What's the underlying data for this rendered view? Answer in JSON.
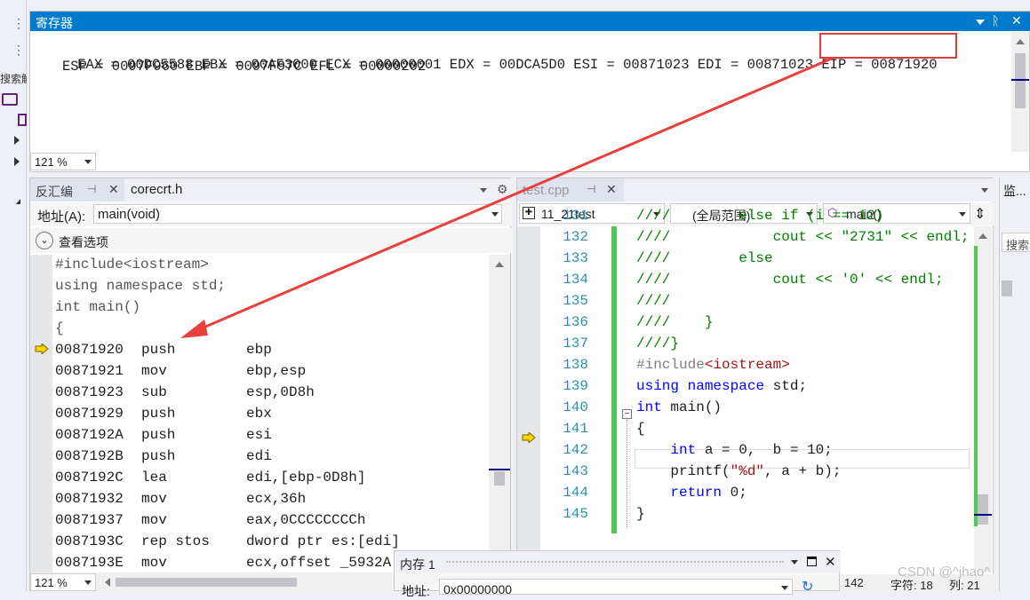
{
  "registers": {
    "title": "寄存器",
    "line1": "EAX = 00DC5588 EBX = 00AF3000 ECX = 00000001 EDX = 00DCA5D0 ESI = 00871023 EDI = 00871023 ",
    "eip": "EIP = 00871920",
    "line2": "ESP = 0097F960 EBP = 0097F97C EFL = 00000202",
    "zoom": "121 %",
    "pin_glyph": "ᚱ",
    "close_glyph": "✕"
  },
  "left_edge": {
    "dots": "⋮",
    "search_label": "搜索解"
  },
  "disasm": {
    "tab_title": "反汇编",
    "tab2": "corecrt.h",
    "address_label": "地址(A):",
    "address_value": "main(void)",
    "view_options": "查看选项",
    "zoom": "121 %",
    "source_lines": [
      "#include<iostream>",
      "using namespace std;",
      "int main()",
      "{"
    ],
    "rows": [
      {
        "addr": "00871920",
        "op": "push",
        "args": "ebp"
      },
      {
        "addr": "00871921",
        "op": "mov",
        "args": "ebp,esp"
      },
      {
        "addr": "00871923",
        "op": "sub",
        "args": "esp,0D8h"
      },
      {
        "addr": "00871929",
        "op": "push",
        "args": "ebx"
      },
      {
        "addr": "0087192A",
        "op": "push",
        "args": "esi"
      },
      {
        "addr": "0087192B",
        "op": "push",
        "args": "edi"
      },
      {
        "addr": "0087192C",
        "op": "lea",
        "args": "edi,[ebp-0D8h]"
      },
      {
        "addr": "00871932",
        "op": "mov",
        "args": "ecx,36h"
      },
      {
        "addr": "00871937",
        "op": "mov",
        "args": "eax,0CCCCCCCCh"
      },
      {
        "addr": "0087193C",
        "op": "rep stos",
        "args": "dword ptr es:[edi]"
      },
      {
        "addr": "0087193E",
        "op": "mov",
        "args": "ecx,offset _5932A"
      }
    ]
  },
  "source": {
    "tab_title": "test.cpp",
    "project": "11_21test",
    "scope": "(全局范围)",
    "function": "main()",
    "status_line": "142",
    "status_char": "字符: 18",
    "status_col": "列: 21",
    "lines": [
      {
        "n": "131",
        "text": "////        else if (i == 12)"
      },
      {
        "n": "132",
        "text": "////            cout << \"2731\" << endl;"
      },
      {
        "n": "133",
        "text": "////        else"
      },
      {
        "n": "134",
        "text": "////            cout << '0' << endl;"
      },
      {
        "n": "135",
        "text": "////"
      },
      {
        "n": "136",
        "text": "////    }"
      },
      {
        "n": "137",
        "text": "////}"
      },
      {
        "n": "138",
        "text": "#include<iostream>"
      },
      {
        "n": "139",
        "text": "using namespace std;"
      },
      {
        "n": "140",
        "text": "int main()"
      },
      {
        "n": "141",
        "text": "{"
      },
      {
        "n": "142",
        "text": "    int a = 0,  b = 10;"
      },
      {
        "n": "143",
        "text": "    printf(\"%d\", a + b);"
      },
      {
        "n": "144",
        "text": "    return 0;"
      },
      {
        "n": "145",
        "text": "}"
      }
    ]
  },
  "right_panel": {
    "title": "监...",
    "search": "搜索"
  },
  "memory": {
    "title": "内存 1",
    "address_label": "地址:",
    "address_value": "0x00000000"
  },
  "watermark": "CSDN @^jhao^",
  "colors": {
    "accent": "#007acc",
    "highlight_box": "#e03a3a",
    "arrow": "#e8403c",
    "change_bar": "#55c75a"
  }
}
